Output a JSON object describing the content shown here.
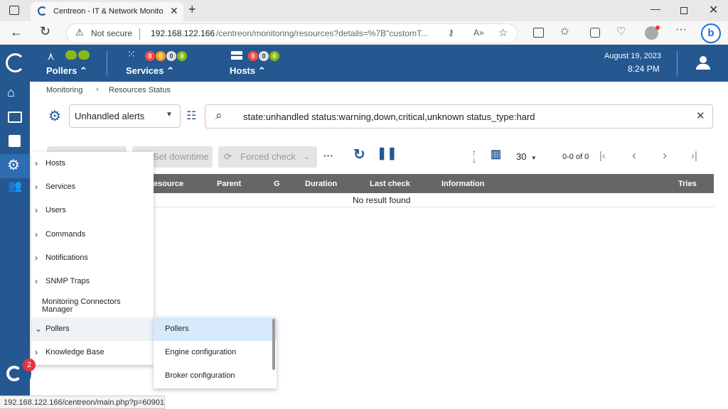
{
  "browser": {
    "tab_title": "Centreon - IT & Network Monito",
    "security_label": "Not secure",
    "url_host": "192.168.122.166",
    "url_path": "/centreon/monitoring/resources?details=%7B\"customT...",
    "status_url": "192.168.122.166/centreon/main.php?p=60901"
  },
  "header": {
    "pollers_label": "Pollers",
    "services_label": "Services",
    "hosts_label": "Hosts",
    "services_counts": [
      "0",
      "0",
      "0",
      "0"
    ],
    "hosts_counts": [
      "0",
      "0",
      "0"
    ],
    "date": "August 19, 2023",
    "time": "8:24 PM"
  },
  "breadcrumb": {
    "root": "Monitoring",
    "current": "Resources Status"
  },
  "filter": {
    "selected": "Unhandled alerts",
    "search_query": "state:unhandled status:warning,down,critical,unknown status_type:hard"
  },
  "toolbar": {
    "set_downtime": "Set downtime",
    "forced_check": "Forced check",
    "page_size": "30",
    "pagination": "0-0 of 0"
  },
  "table": {
    "columns": [
      "Resource",
      "Parent",
      "G",
      "Duration",
      "Last check",
      "Information",
      "Tries"
    ],
    "empty_message": "No result found"
  },
  "config_menu": {
    "items": [
      "Hosts",
      "Services",
      "Users",
      "Commands",
      "Notifications",
      "SNMP Traps",
      "Monitoring Connectors Manager",
      "Pollers",
      "Knowledge Base"
    ]
  },
  "pollers_submenu": {
    "items": [
      "Pollers",
      "Engine configuration",
      "Broker configuration"
    ]
  },
  "notification_badge": "2",
  "colors": {
    "primary": "#255891",
    "critical": "#ff4a4a",
    "warning": "#fd9b27",
    "unknown": "#bcbdc0",
    "ok": "#88b917",
    "table_header": "#666666",
    "menu_highlight": "#d6eafc"
  }
}
